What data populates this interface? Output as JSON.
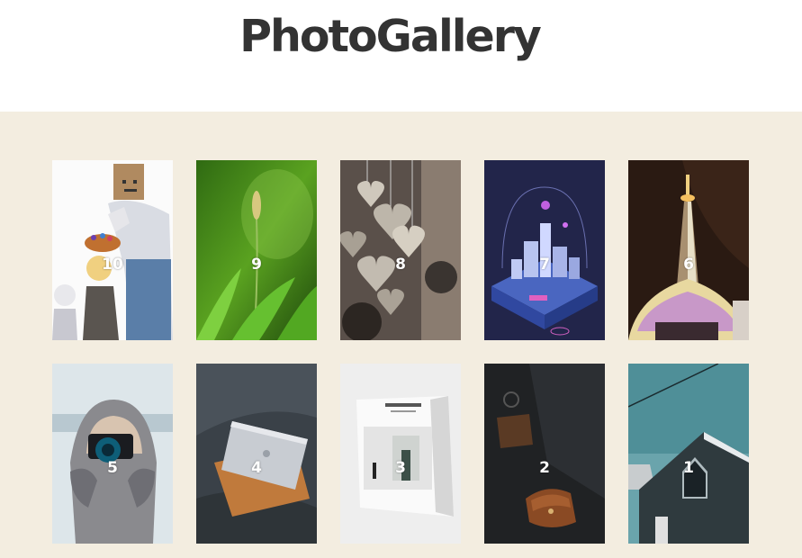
{
  "header": {
    "title": "PhotoGallery"
  },
  "gallery": {
    "photos": [
      {
        "number": "10",
        "subject": "anime-illustration"
      },
      {
        "number": "9",
        "subject": "grass-flower"
      },
      {
        "number": "8",
        "subject": "hanging-hearts"
      },
      {
        "number": "7",
        "subject": "isometric-city"
      },
      {
        "number": "6",
        "subject": "tower-at-night"
      },
      {
        "number": "5",
        "subject": "photographer-in-snow"
      },
      {
        "number": "4",
        "subject": "laptop-on-sofa"
      },
      {
        "number": "3",
        "subject": "open-magazine"
      },
      {
        "number": "2",
        "subject": "leather-wallet"
      },
      {
        "number": "1",
        "subject": "dark-house"
      }
    ]
  },
  "colors": {
    "background": "#f3ede0",
    "title": "#333333",
    "header": "#ffffff"
  }
}
